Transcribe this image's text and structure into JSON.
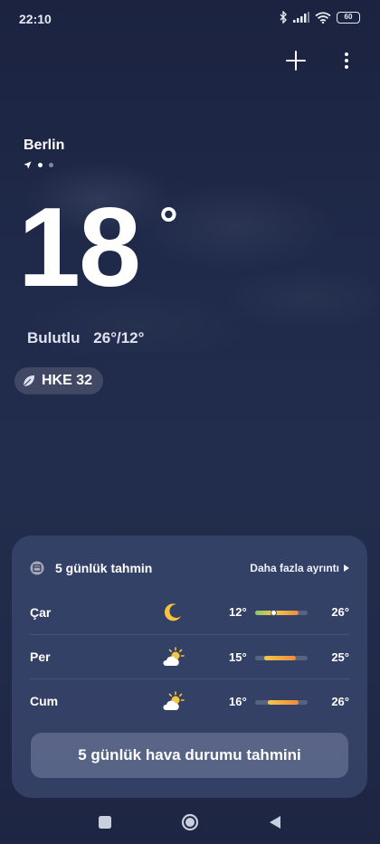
{
  "status_bar": {
    "time": "22:10",
    "battery": "60",
    "icons": [
      "bluetooth-icon",
      "signal-icon",
      "wifi-icon",
      "battery-icon"
    ]
  },
  "header": {
    "add_icon": "plus-icon",
    "menu_icon": "more-vertical-icon"
  },
  "location": {
    "city": "Berlin",
    "page_count": 3,
    "active_page": 1
  },
  "current": {
    "temperature": "18",
    "degree": "°",
    "condition": "Bulutlu",
    "range": "26°/12°"
  },
  "aqi": {
    "label": "HKE 32",
    "icon": "leaf-icon"
  },
  "forecast": {
    "icon": "calendar-icon",
    "title": "5 günlük tahmin",
    "more_label": "Daha fazla ayrıntı",
    "rows": [
      {
        "day": "Çar",
        "icon": "moon-icon",
        "low": "12°",
        "high": "26°"
      },
      {
        "day": "Per",
        "icon": "partly-cloudy-icon",
        "low": "15°",
        "high": "25°"
      },
      {
        "day": "Cum",
        "icon": "partly-cloudy-icon",
        "low": "16°",
        "high": "26°"
      }
    ],
    "button_label": "5 günlük hava durumu tahmini"
  },
  "colors": {
    "background": "#1f2949",
    "bar_green": "#8cc56b",
    "bar_yellow": "#f2c94c",
    "bar_orange": "#f0893a",
    "moon": "#f5c542"
  },
  "navbar": {
    "items": [
      "square-recents-icon",
      "circle-home-icon",
      "triangle-back-icon"
    ]
  }
}
